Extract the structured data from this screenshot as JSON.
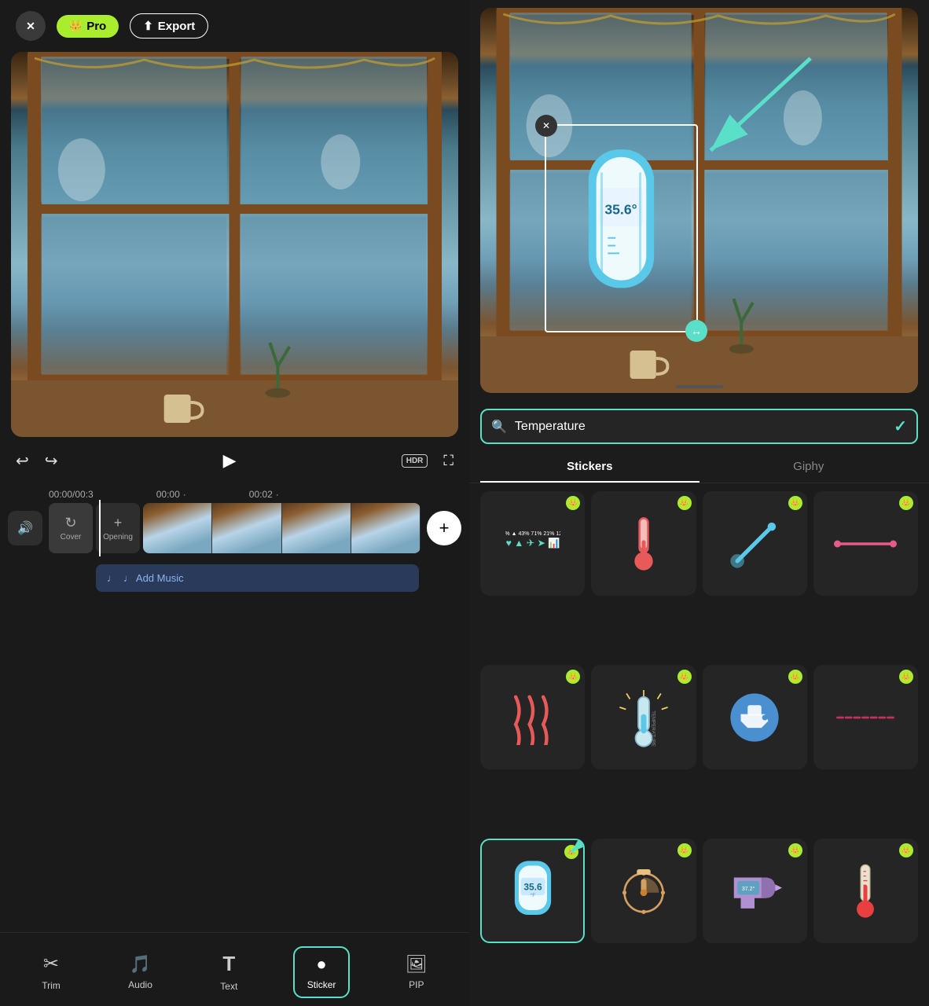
{
  "header": {
    "pro_label": "Pro",
    "export_label": "Export",
    "close_icon": "✕"
  },
  "controls": {
    "undo_icon": "↩",
    "redo_icon": "↪",
    "play_icon": "▶",
    "hdr_label": "HDR",
    "fullscreen_icon": "⛶",
    "time_current": "00:00",
    "time_total": "00:3",
    "time_mid": "00:00",
    "time_dot1": "·",
    "time_end": "00:02",
    "time_dot2": "·"
  },
  "timeline": {
    "add_music_label": "♩ Add Music",
    "add_music_note": "𝅘𝅥𝅮",
    "cover_label": "Cover",
    "opening_label": "Opening",
    "add_icon": "+"
  },
  "toolbar": {
    "items": [
      {
        "id": "trim",
        "label": "Trim",
        "icon": "✂"
      },
      {
        "id": "audio",
        "label": "Audio",
        "icon": "🎵"
      },
      {
        "id": "text",
        "label": "Text",
        "icon": "T"
      },
      {
        "id": "sticker",
        "label": "Sticker",
        "icon": "●",
        "active": true
      },
      {
        "id": "pip",
        "label": "PIP",
        "icon": "🖼"
      }
    ]
  },
  "sticker_panel": {
    "search_placeholder": "Temperature",
    "search_value": "Temperature",
    "check_icon": "✓",
    "tabs": [
      {
        "id": "stickers",
        "label": "Stickers",
        "active": true
      },
      {
        "id": "giphy",
        "label": "Giphy",
        "active": false
      }
    ],
    "stickers": [
      {
        "id": 1,
        "pro": true,
        "type": "stats",
        "icon": "📊"
      },
      {
        "id": 2,
        "pro": true,
        "type": "thermometer-red",
        "icon": "🌡"
      },
      {
        "id": 3,
        "pro": true,
        "type": "thermometer-teal",
        "icon": "💉"
      },
      {
        "id": 4,
        "pro": true,
        "type": "thermometer-line",
        "icon": "➖"
      },
      {
        "id": 5,
        "pro": true,
        "type": "heat-waves",
        "icon": "〰"
      },
      {
        "id": 6,
        "pro": true,
        "type": "thermometer-vintage",
        "icon": "🌡"
      },
      {
        "id": 7,
        "pro": true,
        "type": "medical-gun",
        "icon": "🔫"
      },
      {
        "id": 8,
        "pro": true,
        "type": "thermometer-pink-line",
        "icon": "➖"
      },
      {
        "id": 9,
        "pro": true,
        "type": "thermometer-digital",
        "icon": "🌡",
        "selected": true
      },
      {
        "id": 10,
        "pro": true,
        "type": "clock-therm",
        "icon": "⏱"
      },
      {
        "id": 11,
        "pro": true,
        "type": "medical-gun-2",
        "icon": "🌡"
      },
      {
        "id": 12,
        "pro": true,
        "type": "thermometer-classic",
        "icon": "🌡"
      }
    ]
  },
  "video_preview": {
    "sticker_temp": "35.6°",
    "delete_icon": "✕",
    "resize_icon": "↔"
  }
}
